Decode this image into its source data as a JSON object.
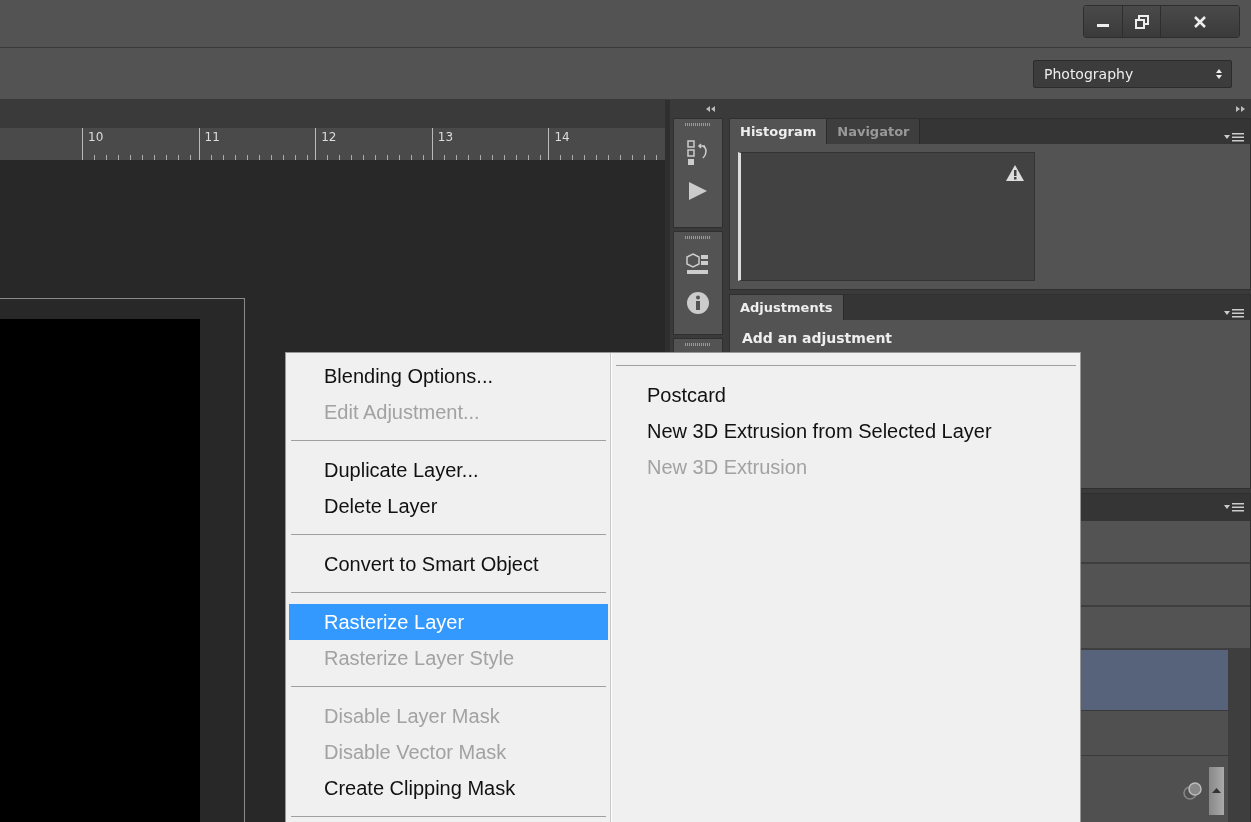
{
  "workspace": {
    "value": "Photography"
  },
  "ruler": {
    "ticks": [
      "10",
      "11",
      "12",
      "13",
      "14"
    ]
  },
  "histogram_panel": {
    "tabs": [
      {
        "label": "Histogram",
        "selected": true
      },
      {
        "label": "Navigator",
        "selected": false
      }
    ]
  },
  "adjustments_panel": {
    "tabs": [
      {
        "label": "Adjustments",
        "selected": true
      }
    ],
    "heading": "Add an adjustment"
  },
  "layers_panel": {
    "rows": [
      {
        "selected": true
      },
      {
        "selected": false
      },
      {
        "selected": false
      }
    ]
  },
  "context_menu": {
    "items": [
      {
        "kind": "item",
        "label": "Blending Options...",
        "disabled": false,
        "selected": false
      },
      {
        "kind": "item",
        "label": "Edit Adjustment...",
        "disabled": true,
        "selected": false
      },
      {
        "kind": "separator"
      },
      {
        "kind": "item",
        "label": "Duplicate Layer...",
        "disabled": false,
        "selected": false
      },
      {
        "kind": "item",
        "label": "Delete Layer",
        "disabled": false,
        "selected": false
      },
      {
        "kind": "separator"
      },
      {
        "kind": "item",
        "label": "Convert to Smart Object",
        "disabled": false,
        "selected": false
      },
      {
        "kind": "separator"
      },
      {
        "kind": "item",
        "label": "Rasterize Layer",
        "disabled": false,
        "selected": true
      },
      {
        "kind": "item",
        "label": "Rasterize Layer Style",
        "disabled": true,
        "selected": false
      },
      {
        "kind": "separator"
      },
      {
        "kind": "item",
        "label": "Disable Layer Mask",
        "disabled": true,
        "selected": false
      },
      {
        "kind": "item",
        "label": "Disable Vector Mask",
        "disabled": true,
        "selected": false
      },
      {
        "kind": "item",
        "label": "Create Clipping Mask",
        "disabled": false,
        "selected": false
      },
      {
        "kind": "separator"
      }
    ],
    "submenu": {
      "items": [
        {
          "kind": "item",
          "label": "Postcard",
          "disabled": false,
          "selected": false
        },
        {
          "kind": "item",
          "label": "New 3D Extrusion from Selected Layer",
          "disabled": false,
          "selected": false
        },
        {
          "kind": "item",
          "label": "New 3D Extrusion",
          "disabled": true,
          "selected": false
        }
      ]
    }
  }
}
